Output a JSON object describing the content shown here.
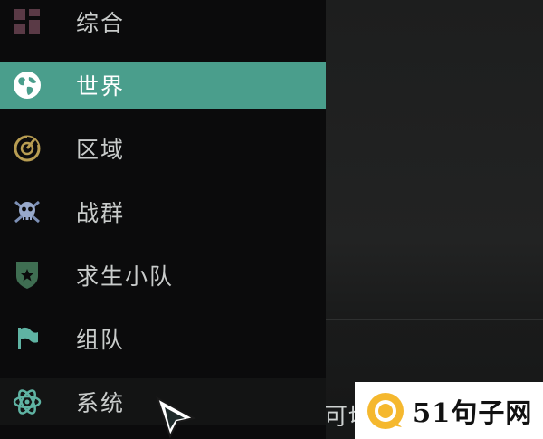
{
  "sidebar": {
    "items": [
      {
        "label": "综合",
        "icon": "grid-icon",
        "active": false
      },
      {
        "label": "世界",
        "icon": "globe-icon",
        "active": true
      },
      {
        "label": "区域",
        "icon": "radar-icon",
        "active": false
      },
      {
        "label": "战群",
        "icon": "skull-crossbones-icon",
        "active": false
      },
      {
        "label": "求生小队",
        "icon": "shield-star-icon",
        "active": false
      },
      {
        "label": "组队",
        "icon": "flag-icon",
        "active": false
      },
      {
        "label": "系统",
        "icon": "atom-icon",
        "active": false
      }
    ]
  },
  "content": {
    "partial_text": "可切"
  },
  "watermark": {
    "text": "51句子网"
  },
  "colors": {
    "active_bg": "#4a9e8c",
    "sidebar_bg": "#0b0b0c",
    "text": "#c9cccb",
    "icon_teal": "#5fb3a3",
    "icon_gold": "#b89d52",
    "watermark_yellow": "#f5b82e"
  }
}
